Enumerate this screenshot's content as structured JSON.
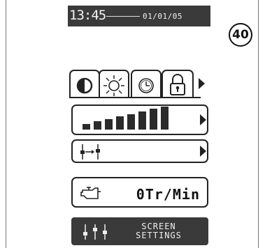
{
  "callout": {
    "number": "40"
  },
  "status_bar": {
    "time": "13:45",
    "date": "01/01/05"
  },
  "tabs": [
    {
      "icon": "contrast-icon"
    },
    {
      "icon": "brightness-icon"
    },
    {
      "icon": "clock-icon"
    },
    {
      "icon": "lock-icon"
    }
  ],
  "brightness_panel": {
    "level": 8,
    "max": 8
  },
  "adjust_panel": {
    "icon": "arrows-adjust-icon"
  },
  "engine_panel": {
    "icon": "engine-icon",
    "value": "0Tr/Min"
  },
  "screen_settings_button": {
    "line1": "SCREEN",
    "line2": "SETTINGS",
    "icon": "sliders-icon"
  }
}
